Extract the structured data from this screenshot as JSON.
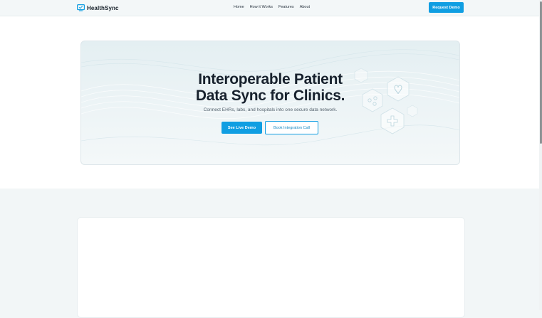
{
  "brand": {
    "name": "HealthSync",
    "accent": "#109ee2",
    "icon": "monitor-icon"
  },
  "nav": {
    "items": [
      {
        "label": "Home"
      },
      {
        "label": "How it Works"
      },
      {
        "label": "Features"
      },
      {
        "label": "About"
      }
    ]
  },
  "header": {
    "cta_label": "Request Demo"
  },
  "hero": {
    "title_line1": "Interoperable Patient",
    "title_line2": "Data Sync for Clinics.",
    "subtitle": "Connect EHRs, labs, and hospitals into one secure data network.",
    "primary_label": "See Live Demo",
    "secondary_label": "Book Integration Call",
    "background_icons": [
      "heart-hexagon-icon",
      "cross-hexagon-icon",
      "molecule-hexagon-icon"
    ]
  }
}
